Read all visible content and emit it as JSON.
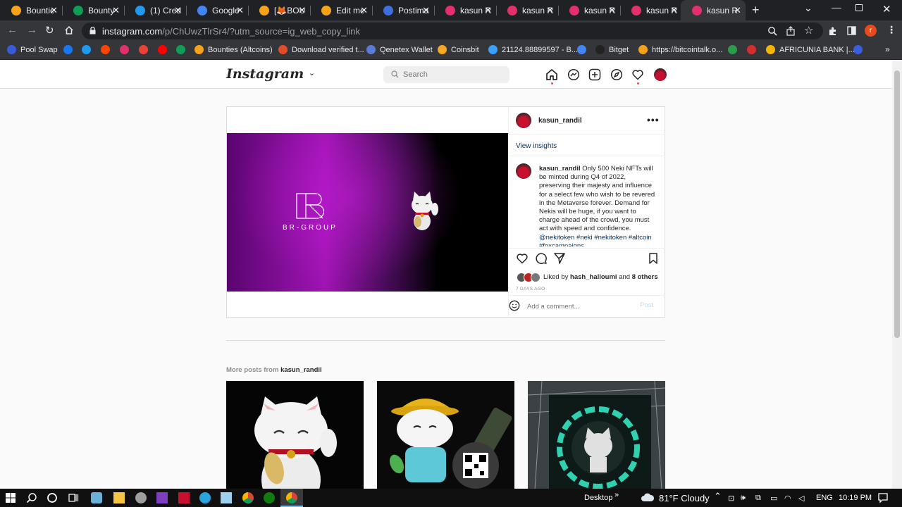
{
  "browser": {
    "tabs": [
      {
        "title": "Bountie",
        "icon": "bitcointalk-icon",
        "color": "#f7a21b"
      },
      {
        "title": "Bounty",
        "icon": "sheets-icon",
        "color": "#0f9d58"
      },
      {
        "title": "(1) Cred",
        "icon": "twitter-icon",
        "color": "#1d9bf0"
      },
      {
        "title": "Google",
        "icon": "translate-icon",
        "color": "#4285f4"
      },
      {
        "title": "[🦊BOU",
        "icon": "bitcointalk-icon",
        "color": "#f7a21b"
      },
      {
        "title": "Edit me",
        "icon": "bitcointalk-icon",
        "color": "#f7a21b"
      },
      {
        "title": "Postima",
        "icon": "postimage-icon",
        "color": "#3d6fe0"
      },
      {
        "title": "kasun R",
        "icon": "instagram-icon",
        "color": "#e1306c"
      },
      {
        "title": "kasun R",
        "icon": "instagram-icon",
        "color": "#e1306c"
      },
      {
        "title": "kasun R",
        "icon": "instagram-icon",
        "color": "#e1306c"
      },
      {
        "title": "kasun R",
        "icon": "instagram-icon",
        "color": "#e1306c"
      },
      {
        "title": "kasun R",
        "icon": "instagram-icon",
        "color": "#e1306c",
        "active": true
      }
    ],
    "url_host": "instagram.com",
    "url_path": "/p/ChUwzTlrSr4/?utm_source=ig_web_copy_link",
    "profile_initial": "r",
    "bookmarks": [
      {
        "label": "Pool Swap",
        "icon": "poolswap-icon"
      },
      {
        "label": "",
        "icon": "facebook-icon"
      },
      {
        "label": "",
        "icon": "twitter-icon"
      },
      {
        "label": "",
        "icon": "reddit-icon"
      },
      {
        "label": "",
        "icon": "instagram-icon"
      },
      {
        "label": "",
        "icon": "gmail-icon"
      },
      {
        "label": "",
        "icon": "youtube-icon"
      },
      {
        "label": "",
        "icon": "drive-icon"
      },
      {
        "label": "Bounties (Altcoins)",
        "icon": "bitcointalk-icon"
      },
      {
        "label": "Download verified t...",
        "icon": "x-icon"
      },
      {
        "label": "Qenetex Wallet",
        "icon": "qenetex-icon"
      },
      {
        "label": "Coinsbit",
        "icon": "coinsbit-icon"
      },
      {
        "label": "21124.88899597 - B...",
        "icon": "aurora-icon"
      },
      {
        "label": "",
        "icon": "translate-icon"
      },
      {
        "label": "Bitget",
        "icon": "bitget-icon"
      },
      {
        "label": "https://bitcointalk.o...",
        "icon": "bitcointalk-icon"
      },
      {
        "label": "",
        "icon": "leaf-icon"
      },
      {
        "label": "",
        "icon": "9k-icon"
      },
      {
        "label": "AFRICUNIA BANK |...",
        "icon": "africunia-icon"
      },
      {
        "label": "",
        "icon": "at-icon"
      }
    ],
    "bookmarks_more": "»"
  },
  "instagram": {
    "logo": "Instagram",
    "logo_chevron": "⌄",
    "search_placeholder": "Search",
    "post": {
      "username": "kasun_randil",
      "more": "•••",
      "view_insights": "View insights",
      "caption_user": "kasun_randil",
      "caption_text": "Only 500 Neki NFTs will be minted during Q4 of 2022, preserving their majesty and influence for a select few who wish to be revered in the Metaverse forever. Demand for Nekis will be huge, if you want to charge ahead of the crowd, you must act with speed and confidence.",
      "caption_tags": "@nekitoken #neki #nekitoken #altcoin #foxcampaigns",
      "media_brand": "BR-GROUP",
      "liked_by_prefix": "Liked by",
      "liked_by_user": "hash_halloumi",
      "liked_and": "and",
      "liked_others": "8 others",
      "time_ago": "7 DAYS AGO",
      "comment_placeholder": "Add a comment...",
      "post_button": "Post"
    },
    "more_posts_prefix": "More posts from",
    "more_posts_user": "kasun_randil"
  },
  "taskbar": {
    "desktop_label": "Desktop",
    "chevron": "»",
    "weather": "81°F  Cloudy",
    "language": "ENG",
    "time": "10:19 PM"
  }
}
